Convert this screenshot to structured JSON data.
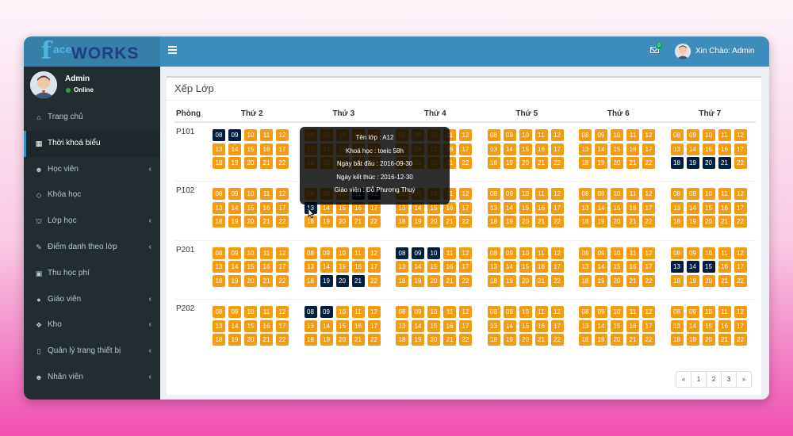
{
  "logo": {
    "f": "f",
    "ace": "ace",
    "works": "WORKS"
  },
  "header": {
    "mail_badge": "0",
    "greeting": "Xin Chào: Admin"
  },
  "user": {
    "name": "Admin",
    "status": "Online"
  },
  "menu": [
    {
      "label": "Trang chủ",
      "icon": "home-icon",
      "glyph": "⌂",
      "chevron": false,
      "active": false
    },
    {
      "label": "Thời khoá biểu",
      "icon": "calendar-icon",
      "glyph": "▦",
      "chevron": false,
      "active": true
    },
    {
      "label": "Học viên",
      "icon": "users-icon",
      "glyph": "☻",
      "chevron": true,
      "active": false
    },
    {
      "label": "Khóa học",
      "icon": "diamond-icon",
      "glyph": "◇",
      "chevron": false,
      "active": false
    },
    {
      "label": "Lớp học",
      "icon": "bank-icon",
      "glyph": "⛫",
      "chevron": true,
      "active": false
    },
    {
      "label": "Điểm danh theo lớp",
      "icon": "edit-icon",
      "glyph": "✎",
      "chevron": true,
      "active": false
    },
    {
      "label": "Thu học phí",
      "icon": "money-icon",
      "glyph": "▣",
      "chevron": false,
      "active": false
    },
    {
      "label": "Giáo viên",
      "icon": "user-icon",
      "glyph": "●",
      "chevron": true,
      "active": false
    },
    {
      "label": "Kho",
      "icon": "cubes-icon",
      "glyph": "❖",
      "chevron": true,
      "active": false
    },
    {
      "label": "Quản lý trang thiết bị",
      "icon": "tablet-icon",
      "glyph": "▯",
      "chevron": true,
      "active": false
    },
    {
      "label": "Nhân viên",
      "icon": "users-group-icon",
      "glyph": "☻",
      "chevron": true,
      "active": false
    }
  ],
  "page_title": "Xếp Lớp",
  "schedule": {
    "room_header": "Phòng",
    "days": [
      "Thứ 2",
      "Thứ 3",
      "Thứ 4",
      "Thứ 5",
      "Thứ 6",
      "Thứ 7"
    ],
    "slots": [
      "08",
      "09",
      "10",
      "11",
      "12",
      "13",
      "14",
      "15",
      "16",
      "17",
      "18",
      "19",
      "20",
      "21",
      "22"
    ],
    "rooms": [
      {
        "name": "P101",
        "booked": [
          [
            "08",
            "09"
          ],
          [],
          [],
          [],
          [],
          [
            "18",
            "19",
            "20",
            "21"
          ]
        ]
      },
      {
        "name": "P102",
        "booked": [
          [],
          [
            "11",
            "12",
            "13"
          ],
          [],
          [],
          [],
          []
        ]
      },
      {
        "name": "P201",
        "booked": [
          [],
          [
            "19",
            "20",
            "21"
          ],
          [
            "08",
            "09",
            "10"
          ],
          [],
          [],
          [
            "13",
            "14",
            "15"
          ]
        ]
      },
      {
        "name": "P202",
        "booked": [
          [],
          [
            "08",
            "09"
          ],
          [],
          [],
          [],
          []
        ]
      }
    ]
  },
  "tooltip": {
    "lines": [
      "Tên lớp : A12",
      "Khoá học : toeic 58h",
      "Ngày bắt đầu : 2016-09-30",
      "Ngày kết thúc : 2016-12-30",
      "Giáo viên : Đỗ Phương Thuý"
    ]
  },
  "pagination": {
    "items": [
      "«",
      "1",
      "2",
      "3",
      "»"
    ]
  },
  "colors": {
    "slot_free": "#f39c12",
    "slot_booked": "#001f3f",
    "header": "#3c8dbc",
    "sidebar": "#222d32"
  }
}
